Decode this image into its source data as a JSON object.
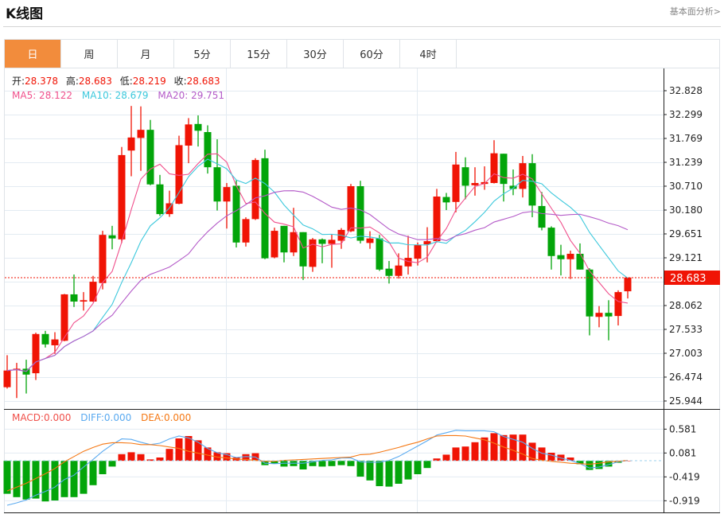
{
  "header": {
    "title": "K线图",
    "fundamental_link": "基本面分析>"
  },
  "tabs": [
    {
      "label": "日",
      "active": true
    },
    {
      "label": "周"
    },
    {
      "label": "月"
    },
    {
      "label": "5分"
    },
    {
      "label": "15分"
    },
    {
      "label": "30分"
    },
    {
      "label": "60分"
    },
    {
      "label": "4时"
    }
  ],
  "ohlc_legend": {
    "open_label": "开:",
    "open": "28.378",
    "high_label": "高:",
    "high": "28.683",
    "low_label": "低:",
    "low": "28.219",
    "close_label": "收:",
    "close": "28.683"
  },
  "ma_legend": {
    "ma5": "MA5: 28.122",
    "ma10": "MA10: 28.679",
    "ma20": "MA20: 29.751"
  },
  "macd_legend": {
    "macd": "MACD:0.000",
    "diff": "DIFF:0.000",
    "dea": "DEA:0.000"
  },
  "last_price": "28.683",
  "colors": {
    "up": "#f01405",
    "down": "#03a50a",
    "ma5": "#f0508c",
    "ma10": "#3cc8dc",
    "ma20": "#b45ac8",
    "diff": "#5aaaf0",
    "dea": "#f57814",
    "tab_active": "#f28c3c"
  },
  "chart_data": [
    {
      "type": "candlestick",
      "y_ticks": [
        "32.828",
        "32.299",
        "31.769",
        "31.239",
        "30.710",
        "30.180",
        "29.651",
        "29.121",
        "28.062",
        "27.533",
        "27.003",
        "26.474",
        "25.944"
      ],
      "ylim": [
        25.944,
        32.828
      ],
      "grid": true,
      "candles": [
        [
          26.25,
          26.96,
          26.22,
          26.62
        ],
        [
          26.63,
          26.79,
          26.01,
          26.66
        ],
        [
          26.66,
          26.86,
          26.11,
          26.53
        ],
        [
          26.56,
          27.46,
          26.41,
          27.43
        ],
        [
          27.43,
          27.5,
          27.13,
          27.2
        ],
        [
          27.18,
          27.47,
          26.99,
          27.31
        ],
        [
          27.28,
          28.32,
          27.27,
          28.31
        ],
        [
          28.31,
          28.75,
          28.03,
          28.15
        ],
        [
          28.15,
          28.36,
          27.95,
          28.18
        ],
        [
          28.15,
          28.72,
          28.14,
          28.59
        ],
        [
          28.56,
          29.72,
          28.42,
          29.63
        ],
        [
          29.62,
          29.83,
          29.31,
          29.55
        ],
        [
          29.53,
          31.58,
          29.45,
          31.4
        ],
        [
          31.5,
          32.49,
          30.93,
          31.79
        ],
        [
          31.78,
          32.48,
          31.05,
          31.96
        ],
        [
          31.96,
          32.18,
          30.73,
          30.75
        ],
        [
          30.75,
          30.96,
          30.05,
          30.09
        ],
        [
          30.09,
          30.61,
          30.03,
          30.33
        ],
        [
          30.32,
          31.83,
          30.31,
          31.62
        ],
        [
          31.61,
          32.22,
          31.22,
          32.08
        ],
        [
          32.09,
          32.28,
          31.59,
          31.94
        ],
        [
          31.91,
          32.06,
          30.99,
          31.13
        ],
        [
          31.13,
          31.75,
          30.17,
          30.37
        ],
        [
          30.37,
          30.78,
          29.77,
          30.69
        ],
        [
          30.72,
          30.84,
          29.35,
          29.46
        ],
        [
          29.46,
          30.02,
          29.37,
          29.98
        ],
        [
          29.98,
          31.33,
          29.96,
          31.29
        ],
        [
          31.33,
          31.52,
          29.09,
          29.11
        ],
        [
          29.13,
          29.79,
          29.11,
          29.72
        ],
        [
          29.83,
          29.83,
          29.02,
          29.24
        ],
        [
          29.24,
          30.23,
          29.16,
          29.69
        ],
        [
          29.69,
          29.69,
          28.63,
          28.93
        ],
        [
          28.92,
          29.56,
          28.81,
          29.53
        ],
        [
          29.53,
          29.55,
          29.0,
          29.43
        ],
        [
          29.43,
          29.65,
          28.9,
          29.52
        ],
        [
          29.5,
          29.78,
          29.32,
          29.74
        ],
        [
          29.71,
          30.76,
          29.69,
          30.71
        ],
        [
          30.71,
          30.83,
          29.44,
          29.5
        ],
        [
          29.45,
          29.71,
          29.32,
          29.55
        ],
        [
          29.55,
          29.63,
          28.83,
          28.86
        ],
        [
          28.88,
          29.05,
          28.55,
          28.72
        ],
        [
          28.72,
          29.22,
          28.66,
          28.95
        ],
        [
          28.93,
          29.61,
          28.75,
          29.12
        ],
        [
          29.1,
          29.46,
          28.95,
          29.41
        ],
        [
          29.42,
          29.8,
          29.02,
          29.49
        ],
        [
          29.49,
          30.65,
          29.46,
          30.48
        ],
        [
          30.47,
          30.56,
          30.18,
          30.35
        ],
        [
          30.36,
          31.47,
          30.13,
          31.19
        ],
        [
          31.13,
          31.35,
          30.42,
          30.72
        ],
        [
          30.73,
          31.13,
          30.5,
          30.78
        ],
        [
          30.76,
          31.15,
          30.63,
          30.8
        ],
        [
          30.78,
          31.73,
          30.77,
          31.44
        ],
        [
          31.43,
          31.43,
          30.37,
          30.76
        ],
        [
          30.72,
          31.08,
          30.51,
          30.65
        ],
        [
          30.65,
          31.38,
          30.46,
          31.22
        ],
        [
          31.22,
          31.42,
          30.02,
          30.28
        ],
        [
          30.27,
          30.58,
          29.73,
          29.79
        ],
        [
          29.79,
          29.82,
          28.86,
          29.16
        ],
        [
          29.18,
          29.41,
          28.73,
          29.09
        ],
        [
          29.09,
          29.28,
          28.65,
          29.21
        ],
        [
          29.21,
          29.44,
          28.86,
          28.86
        ],
        [
          28.86,
          28.89,
          27.4,
          27.82
        ],
        [
          27.81,
          28.05,
          27.58,
          27.9
        ],
        [
          27.9,
          28.18,
          27.29,
          27.82
        ],
        [
          27.83,
          28.4,
          27.62,
          28.36
        ],
        [
          28.378,
          28.683,
          28.219,
          28.683
        ]
      ],
      "candle_format": [
        "open",
        "high",
        "low",
        "close"
      ],
      "series": [
        {
          "name": "MA5",
          "period": 5
        },
        {
          "name": "MA10",
          "period": 10
        },
        {
          "name": "MA20",
          "period": 20
        }
      ]
    },
    {
      "type": "bar+line",
      "y_ticks": [
        "0.581",
        "0.081",
        "-0.419",
        "-0.919"
      ],
      "ylim": [
        -0.95,
        0.62
      ],
      "macd": [
        -0.69,
        -0.76,
        -0.81,
        -0.79,
        -0.85,
        -0.83,
        -0.76,
        -0.76,
        -0.69,
        -0.51,
        -0.28,
        -0.12,
        0.14,
        0.18,
        0.14,
        0.03,
        0.07,
        0.25,
        0.47,
        0.52,
        0.43,
        0.28,
        0.18,
        0.16,
        0.07,
        0.14,
        0.16,
        -0.09,
        -0.06,
        -0.12,
        -0.11,
        -0.18,
        -0.11,
        -0.12,
        -0.11,
        -0.09,
        -0.11,
        -0.33,
        -0.41,
        -0.53,
        -0.54,
        -0.48,
        -0.39,
        -0.28,
        -0.15,
        0.05,
        0.13,
        0.28,
        0.3,
        0.39,
        0.49,
        0.58,
        0.54,
        0.55,
        0.55,
        0.38,
        0.28,
        0.17,
        0.13,
        0.07,
        -0.07,
        -0.19,
        -0.17,
        -0.12,
        -0.04,
        0.0
      ],
      "diff": [
        -0.93,
        -0.88,
        -0.82,
        -0.72,
        -0.64,
        -0.55,
        -0.39,
        -0.3,
        -0.13,
        0.03,
        0.2,
        0.34,
        0.46,
        0.45,
        0.39,
        0.34,
        0.37,
        0.46,
        0.52,
        0.48,
        0.39,
        0.26,
        0.17,
        0.13,
        0.07,
        0.09,
        0.08,
        -0.05,
        -0.06,
        -0.05,
        -0.05,
        -0.05,
        -0.02,
        0.01,
        0.02,
        0.06,
        0.06,
        -0.02,
        -0.03,
        -0.03,
        0.01,
        0.09,
        0.2,
        0.31,
        0.42,
        0.54,
        0.59,
        0.64,
        0.63,
        0.63,
        0.63,
        0.61,
        0.51,
        0.45,
        0.39,
        0.26,
        0.16,
        0.12,
        0.06,
        0.01,
        -0.06,
        -0.15,
        -0.13,
        -0.08,
        -0.02,
        0.01
      ],
      "dea": [
        -0.63,
        -0.55,
        -0.47,
        -0.37,
        -0.27,
        -0.16,
        -0.02,
        0.09,
        0.2,
        0.28,
        0.35,
        0.38,
        0.38,
        0.37,
        0.34,
        0.34,
        0.32,
        0.29,
        0.26,
        0.2,
        0.16,
        0.12,
        0.08,
        0.06,
        0.04,
        0.03,
        0.01,
        -0.01,
        -0.01,
        0.01,
        0.02,
        0.03,
        0.04,
        0.05,
        0.06,
        0.07,
        0.08,
        0.13,
        0.14,
        0.18,
        0.23,
        0.28,
        0.34,
        0.39,
        0.46,
        0.52,
        0.53,
        0.53,
        0.52,
        0.48,
        0.44,
        0.37,
        0.29,
        0.22,
        0.14,
        0.05,
        0.01,
        -0.01,
        -0.03,
        -0.05,
        -0.06,
        -0.07,
        -0.05,
        -0.02,
        -0.01,
        0.01
      ]
    }
  ]
}
